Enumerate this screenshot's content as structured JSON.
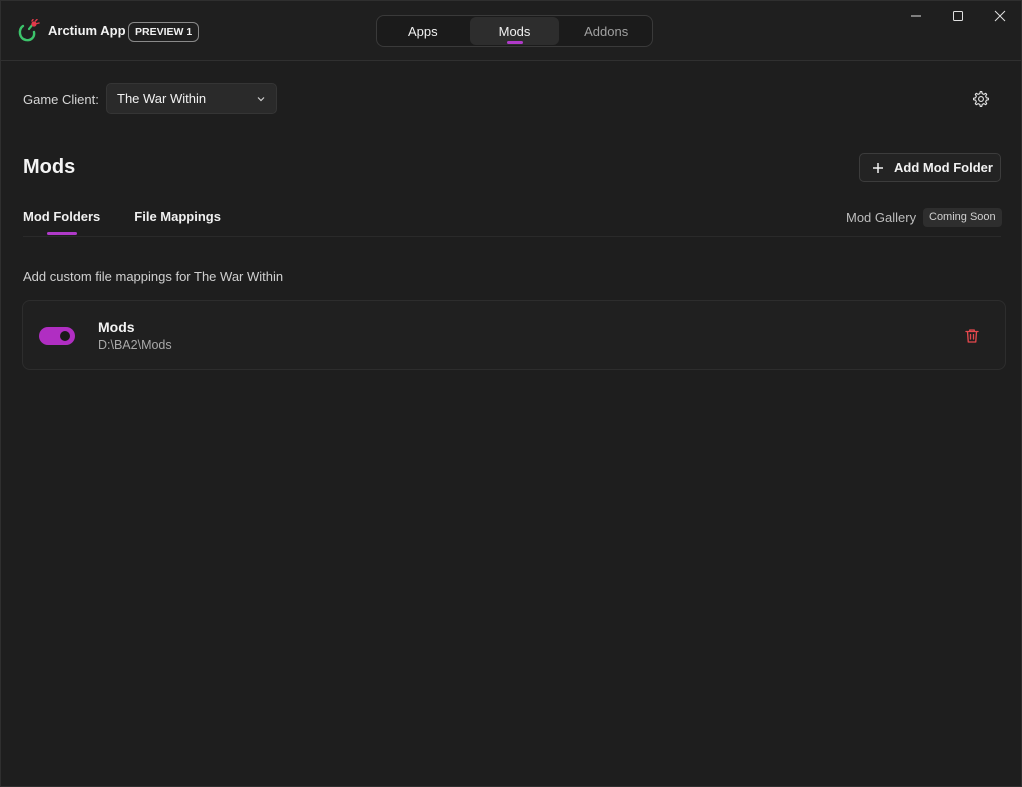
{
  "titlebar": {
    "app_name": "Arctium App",
    "badge": "PREVIEW 1",
    "logo_icon": "arctium-logo-icon",
    "nav_tabs": [
      {
        "label": "Apps",
        "active": false
      },
      {
        "label": "Mods",
        "active": true
      },
      {
        "label": "Addons",
        "active": false
      }
    ],
    "controls": [
      "minimize-icon",
      "maximize-icon",
      "close-icon"
    ]
  },
  "client": {
    "label": "Game Client:",
    "selected": "The War Within"
  },
  "page": {
    "title": "Mods",
    "add_button": "Add Mod Folder",
    "sub_tabs": [
      {
        "label": "Mod Folders",
        "active": true
      },
      {
        "label": "File Mappings",
        "active": false
      }
    ],
    "gallery_label": "Mod Gallery",
    "gallery_badge": "Coming Soon",
    "hint": "Add custom file mappings for The War Within"
  },
  "mods": [
    {
      "name": "Mods",
      "path": "D:\\BA2\\Mods",
      "enabled": true
    }
  ],
  "colors": {
    "accent": "#b03ac9",
    "delete": "#e5484d"
  }
}
